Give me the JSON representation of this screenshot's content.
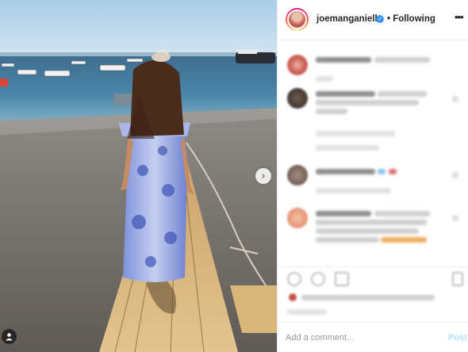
{
  "post": {
    "username": "joemanganiello",
    "follow_status": "Following",
    "separator": "•",
    "verified_mark": "✓",
    "more_icon": "more-horizontal-icon"
  },
  "media": {
    "next_glyph": "›",
    "user_tag_icon": "user-tag-icon"
  },
  "add_comment": {
    "placeholder": "Add a comment...",
    "post_label": "Post"
  },
  "colors": {
    "link_blue": "#3897f0",
    "post_disabled": "#b2dffc",
    "text": "#262626",
    "border": "#efefef"
  }
}
